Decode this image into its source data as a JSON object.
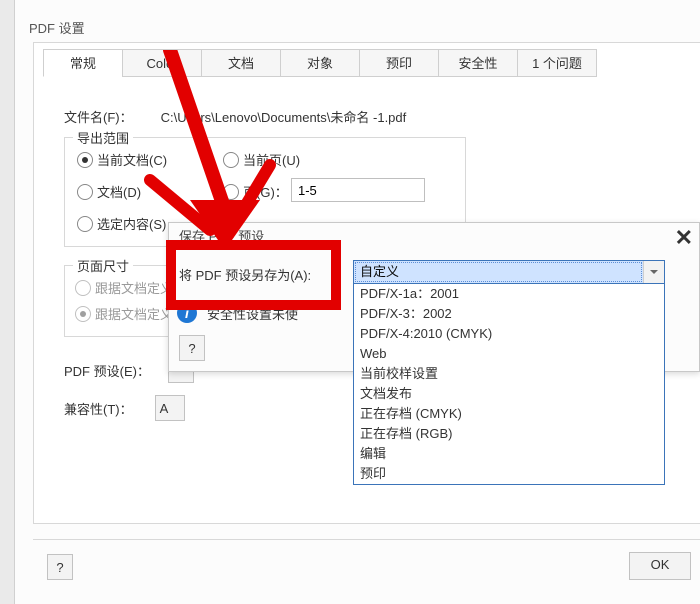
{
  "dialog": {
    "title": "PDF 设置",
    "tabs": [
      {
        "id": "general",
        "label": "常规"
      },
      {
        "id": "color",
        "label": "Color"
      },
      {
        "id": "document",
        "label": "文档"
      },
      {
        "id": "objects",
        "label": "对象"
      },
      {
        "id": "prepress",
        "label": "预印"
      },
      {
        "id": "security",
        "label": "安全性"
      },
      {
        "id": "issues",
        "label": "1 个问题"
      }
    ],
    "active_tab": "general"
  },
  "general": {
    "filename_label": "文件名(F)：",
    "filename_value": "C:\\Users\\Lenovo\\Documents\\未命名 -1.pdf",
    "export_range": {
      "legend": "导出范围",
      "current_document_label": "当前文档(C)",
      "current_page_label": "当前页(U)",
      "documents_label": "文档(D)",
      "pages_label": "页(G)：",
      "pages_value": "1-5",
      "selection_label": "选定内容(S)"
    },
    "page_size": {
      "legend": "页面尺寸",
      "by_doc1_label": "跟据文档定义",
      "by_doc2_label": "跟据文档定义"
    },
    "pdf_preset_label": "PDF 预设(E)：",
    "compatibility_label": "兼容性(T)：",
    "compat_value_prefix": "A"
  },
  "popup": {
    "title": "保存 PDF 预设",
    "save_as_label": "将 PDF 预设另存为(A):",
    "info_text": "安全性设置未使",
    "help": "?",
    "close": "✕"
  },
  "preset_combo": {
    "selected": "自定义",
    "options": [
      "PDF/X-1a：2001",
      "PDF/X-3：2002",
      "PDF/X-4:2010 (CMYK)",
      "Web",
      "当前校样设置",
      "文档发布",
      "正在存档 (CMYK)",
      "正在存档 (RGB)",
      "编辑",
      "预印"
    ]
  },
  "buttons": {
    "help": "?",
    "ok": "OK"
  }
}
